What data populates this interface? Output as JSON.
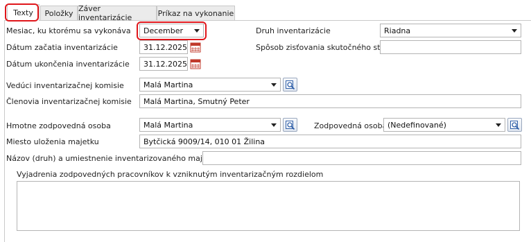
{
  "tabs": [
    {
      "label": "Texty",
      "active": true
    },
    {
      "label": "Položky"
    },
    {
      "label": "Záver inventarizácie"
    },
    {
      "label": "Príkaz na vykonanie"
    }
  ],
  "form": {
    "month_label": "Mesiac, ku ktorému sa vykonáva",
    "month_value": "December",
    "inventory_type_label": "Druh inventarizácie",
    "inventory_type_value": "Riadna",
    "start_date_label": "Dátum začatia inventarizácie",
    "start_date_value": "31.12.2025",
    "method_label": "Spôsob zisťovania skutočného stavu",
    "method_value": "",
    "end_date_label": "Dátum ukončenia inventarizácie",
    "end_date_value": "31.12.2025",
    "chair_label": "Vedúci inventarizačnej komisie",
    "chair_value": "Malá Martina",
    "members_label": "Členovia inventarizačnej komisie",
    "members_value": "Malá Martina, Smutný Peter",
    "material_person_label": "Hmotne zodpovedná osoba",
    "material_person_value": "Malá Martina",
    "responsible_person_label": "Zodpovedná osoba",
    "responsible_person_value": "(Nedefinované)",
    "location_label": "Miesto uloženia majetku",
    "location_value": "Bytčická 9009/14, 010 01 Žilina",
    "asset_name_label": "Názov (druh) a umiestnenie inventarizovaného majetku",
    "asset_name_value": "",
    "statements_label": "Vyjadrenia zodpovedných pracovníkov k vzniknutým inventarizačným rozdielom",
    "statements_value": ""
  },
  "colors": {
    "highlight": "#e0161b",
    "calendar_icon": "#c0392b",
    "lookup_icon": "#2f5fa8"
  }
}
